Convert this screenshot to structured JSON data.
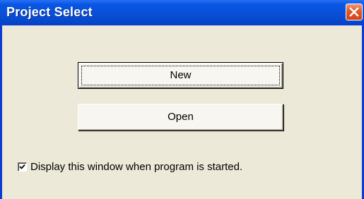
{
  "window": {
    "title": "Project Select"
  },
  "buttons": {
    "new_label": "New",
    "open_label": "Open"
  },
  "options": {
    "show_on_start_label": "Display this window when program is started.",
    "show_on_start_checked": true
  },
  "icons": {
    "close": "close-icon",
    "check": "checkmark-icon"
  },
  "colors": {
    "titlebar": "#0a4fd8",
    "window_bg": "#ece9d8",
    "close_button": "#e0592b"
  }
}
